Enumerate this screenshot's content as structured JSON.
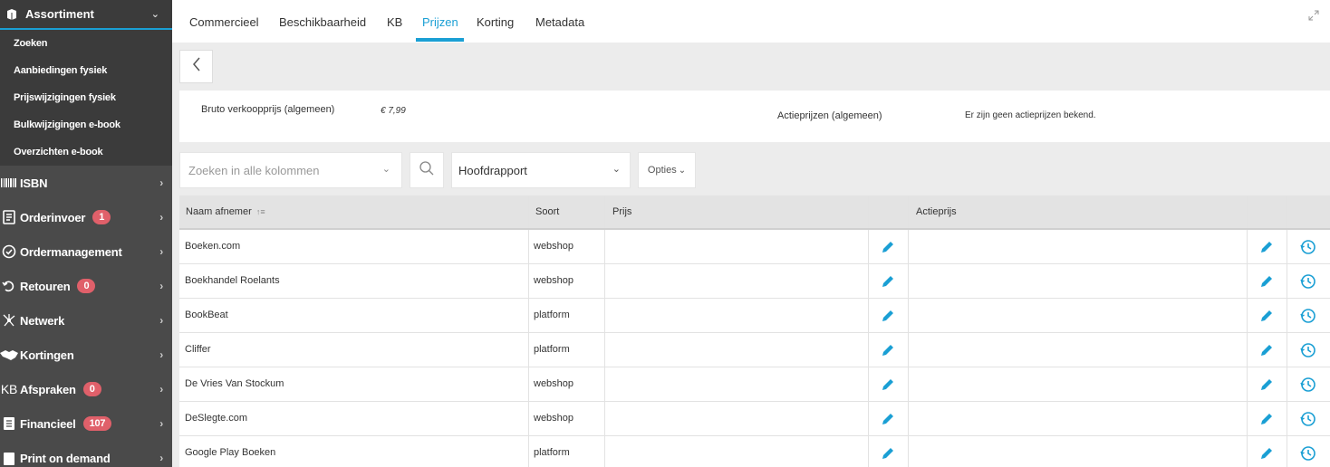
{
  "sidebar": {
    "header": {
      "label": "Assortiment"
    },
    "sub_items": [
      "Zoeken",
      "Aanbiedingen fysiek",
      "Prijswijzigingen fysiek",
      "Bulkwijzigingen e-book",
      "Overzichten e-book"
    ],
    "items": [
      {
        "label": "ISBN",
        "icon": "barcode-icon",
        "badge": null
      },
      {
        "label": "Orderinvoer",
        "icon": "order-entry-icon",
        "badge": "1"
      },
      {
        "label": "Ordermanagement",
        "icon": "check-circle-icon",
        "badge": null
      },
      {
        "label": "Retouren",
        "icon": "return-icon",
        "badge": "0"
      },
      {
        "label": "Netwerk",
        "icon": "network-icon",
        "badge": null
      },
      {
        "label": "Kortingen",
        "icon": "handshake-icon",
        "badge": null
      },
      {
        "label": "Afspraken",
        "icon": "kb-logo-icon",
        "badge": "0"
      },
      {
        "label": "Financieel",
        "icon": "finance-icon",
        "badge": "107"
      },
      {
        "label": "Print on demand",
        "icon": "print-icon",
        "badge": null
      }
    ]
  },
  "tabs": [
    "Commercieel",
    "Beschikbaarheid",
    "KB",
    "Prijzen",
    "Korting",
    "Metadata"
  ],
  "active_tab": "Prijzen",
  "price_panel": {
    "bruto_label": "Bruto verkoopprijs (algemeen)",
    "bruto_value": "€ 7,99",
    "actie_label": "Actieprijzen (algemeen)",
    "actie_value": "Er zijn geen actieprijzen bekend."
  },
  "search": {
    "placeholder": "Zoeken in alle kolommen"
  },
  "report": {
    "selected": "Hoofdrapport"
  },
  "options_label": "Opties",
  "table": {
    "headers": {
      "naam": "Naam afnemer",
      "sort_indicator": "↑≡",
      "soort": "Soort",
      "prijs": "Prijs",
      "actieprijs": "Actieprijs"
    },
    "rows": [
      {
        "naam": "Boeken.com",
        "soort": "webshop"
      },
      {
        "naam": "Boekhandel Roelants",
        "soort": "webshop"
      },
      {
        "naam": "BookBeat",
        "soort": "platform"
      },
      {
        "naam": "Cliffer",
        "soort": "platform"
      },
      {
        "naam": "De Vries Van Stockum",
        "soort": "webshop"
      },
      {
        "naam": "DeSlegte.com",
        "soort": "webshop"
      },
      {
        "naam": "Google Play Boeken",
        "soort": "platform"
      }
    ]
  },
  "colors": {
    "accent": "#1a9fd4",
    "sidebar_bg": "#4a4a4a",
    "badge": "#e0606a"
  }
}
